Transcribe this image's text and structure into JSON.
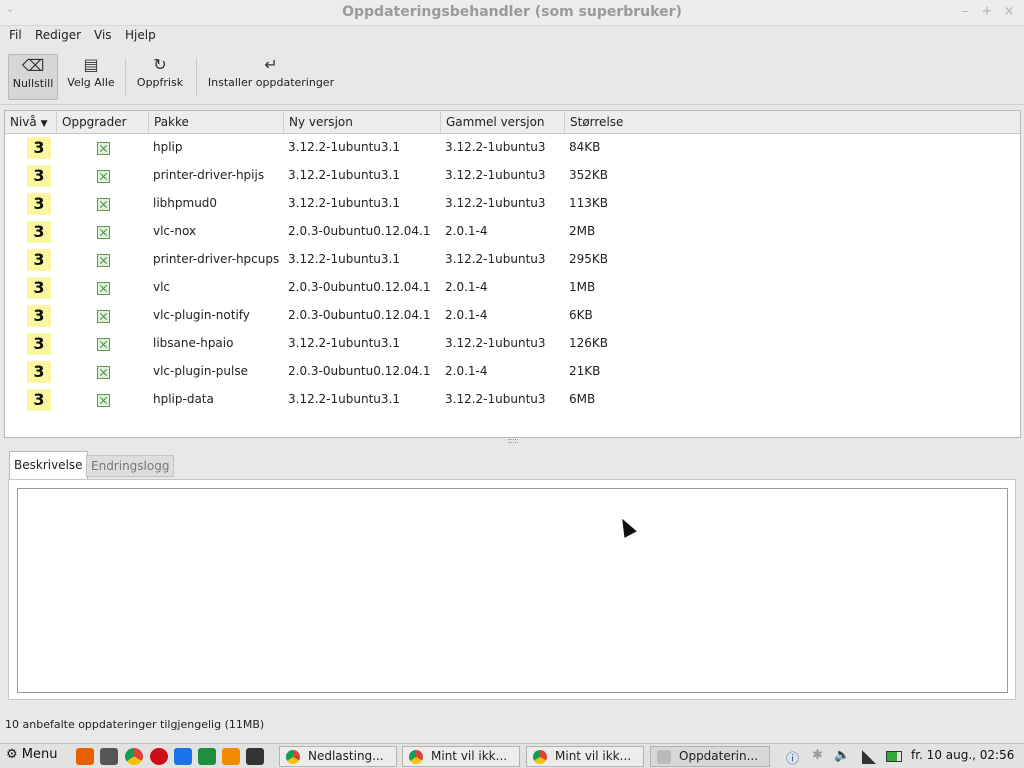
{
  "window": {
    "title": "Oppdateringsbehandler (som superbruker)",
    "menu_glyph": "⌄",
    "minimize": "–",
    "maximize": "+",
    "close": "×"
  },
  "menubar": {
    "items": [
      {
        "label": "Fil",
        "accel": "F"
      },
      {
        "label": "Rediger",
        "accel": "R"
      },
      {
        "label": "Vis",
        "accel": "V"
      },
      {
        "label": "Hjelp",
        "accel": "H"
      }
    ]
  },
  "toolbar": {
    "clear": {
      "label": "Nullstill",
      "icon": "⌫"
    },
    "select_all": {
      "label": "Velg Alle",
      "icon": "▤"
    },
    "refresh": {
      "label": "Oppfrisk",
      "icon": "↻"
    },
    "install": {
      "label": "Installer oppdateringer",
      "icon": "↵"
    }
  },
  "table": {
    "columns": {
      "level": "Nivå",
      "upgrade": "Oppgrader",
      "package": "Pakke",
      "new_version": "Ny versjon",
      "old_version": "Gammel versjon",
      "size": "Størrelse"
    },
    "sort_indicator": "▼",
    "rows": [
      {
        "level": "3",
        "package": "hplip",
        "new_version": "3.12.2-1ubuntu3.1",
        "old_version": "3.12.2-1ubuntu3",
        "size": "84KB"
      },
      {
        "level": "3",
        "package": "printer-driver-hpijs",
        "new_version": "3.12.2-1ubuntu3.1",
        "old_version": "3.12.2-1ubuntu3",
        "size": "352KB"
      },
      {
        "level": "3",
        "package": "libhpmud0",
        "new_version": "3.12.2-1ubuntu3.1",
        "old_version": "3.12.2-1ubuntu3",
        "size": "113KB"
      },
      {
        "level": "3",
        "package": "vlc-nox",
        "new_version": "2.0.3-0ubuntu0.12.04.1",
        "old_version": "2.0.1-4",
        "size": "2MB"
      },
      {
        "level": "3",
        "package": "printer-driver-hpcups",
        "new_version": "3.12.2-1ubuntu3.1",
        "old_version": "3.12.2-1ubuntu3",
        "size": "295KB"
      },
      {
        "level": "3",
        "package": "vlc",
        "new_version": "2.0.3-0ubuntu0.12.04.1",
        "old_version": "2.0.1-4",
        "size": "1MB"
      },
      {
        "level": "3",
        "package": "vlc-plugin-notify",
        "new_version": "2.0.3-0ubuntu0.12.04.1",
        "old_version": "2.0.1-4",
        "size": "6KB"
      },
      {
        "level": "3",
        "package": "libsane-hpaio",
        "new_version": "3.12.2-1ubuntu3.1",
        "old_version": "3.12.2-1ubuntu3",
        "size": "126KB"
      },
      {
        "level": "3",
        "package": "vlc-plugin-pulse",
        "new_version": "2.0.3-0ubuntu0.12.04.1",
        "old_version": "2.0.1-4",
        "size": "21KB"
      },
      {
        "level": "3",
        "package": "hplip-data",
        "new_version": "3.12.2-1ubuntu3.1",
        "old_version": "3.12.2-1ubuntu3",
        "size": "6MB"
      }
    ]
  },
  "tabs": {
    "description": "Beskrivelse",
    "changelog": "Endringslogg"
  },
  "status": "10 anbefalte oppdateringer tilgjengelig (11MB)",
  "panel": {
    "menu_label": "Menu",
    "menu_icon": "⚙",
    "tasks": [
      {
        "label": "Nedlasting..."
      },
      {
        "label": "Mint vil ikk..."
      },
      {
        "label": "Mint vil ikk..."
      },
      {
        "label": "Oppdaterin..."
      }
    ],
    "tray": {
      "bluetooth": "✱",
      "volume": "🔈",
      "info": "ⓘ"
    },
    "clock": "fr. 10 aug., 02:56"
  },
  "colors": {
    "level_badge": "#fbf7a0",
    "firefox": "#e66000",
    "terminal": "#333333",
    "libreoffice": "#1a73e8",
    "calc": "#1e8e3e",
    "vlc": "#f08a00",
    "opera": "#cc0f16"
  }
}
